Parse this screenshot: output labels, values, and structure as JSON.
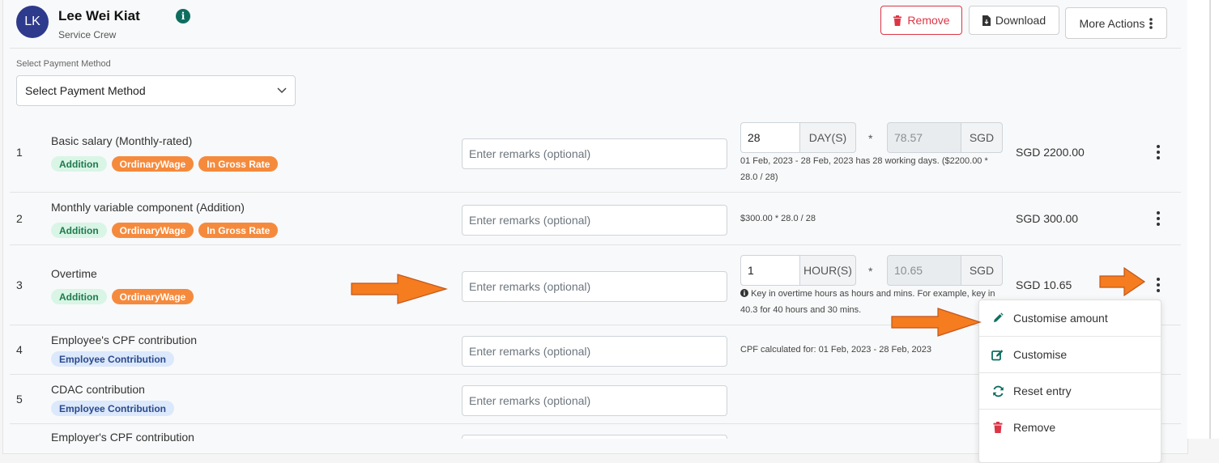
{
  "employee": {
    "initials": "LK",
    "name": "Lee Wei Kiat",
    "role": "Service Crew",
    "info_icon": "info-icon"
  },
  "toolbar": {
    "remove_label": "Remove",
    "download_label": "Download",
    "more_actions_label": "More Actions"
  },
  "payment_method": {
    "label": "Select Payment Method",
    "selected": "Select Payment Method"
  },
  "remarks_placeholder": "Enter remarks (optional)",
  "items": [
    {
      "num": "1",
      "name": "Basic salary (Monthly-rated)",
      "badges": [
        "Addition",
        "OrdinaryWage",
        "In Gross Rate"
      ],
      "qty": "28",
      "unit": "DAY(S)",
      "times": "*",
      "rate": "78.57",
      "currency": "SGD",
      "note": "01 Feb, 2023 - 28 Feb, 2023 has 28 working days. ($2200.00 * 28.0 / 28)",
      "amount": "SGD 2200.00"
    },
    {
      "num": "2",
      "name": "Monthly variable component (Addition)",
      "badges": [
        "Addition",
        "OrdinaryWage",
        "In Gross Rate"
      ],
      "note": "$300.00 * 28.0 / 28",
      "amount": "SGD 300.00"
    },
    {
      "num": "3",
      "name": "Overtime",
      "badges": [
        "Addition",
        "OrdinaryWage"
      ],
      "qty": "1",
      "unit": "HOUR(S)",
      "times": "*",
      "rate": "10.65",
      "currency": "SGD",
      "note": "Key in overtime hours as hours and mins. For example, key in 40.3 for 40 hours and 30 mins.",
      "amount": "SGD 10.65"
    },
    {
      "num": "4",
      "name": "Employee's CPF contribution",
      "badges": [
        "Employee Contribution"
      ],
      "note": "CPF calculated for: 01 Feb, 2023 - 28 Feb, 2023"
    },
    {
      "num": "5",
      "name": "CDAC contribution",
      "badges": [
        "Employee Contribution"
      ]
    },
    {
      "num": "",
      "name": "Employer's CPF contribution"
    }
  ],
  "context_menu": {
    "items": [
      {
        "label": "Customise amount",
        "icon": "pencil-icon"
      },
      {
        "label": "Customise",
        "icon": "edit-square-icon"
      },
      {
        "label": "Reset entry",
        "icon": "refresh-icon"
      },
      {
        "label": "Remove",
        "icon": "trash-icon"
      }
    ]
  },
  "colors": {
    "accent_green": "#0d6e5f",
    "danger": "#dc3545",
    "badge_orange": "#f58a3d",
    "arrow_orange": "#f57c1f",
    "avatar": "#2e3a8c"
  }
}
